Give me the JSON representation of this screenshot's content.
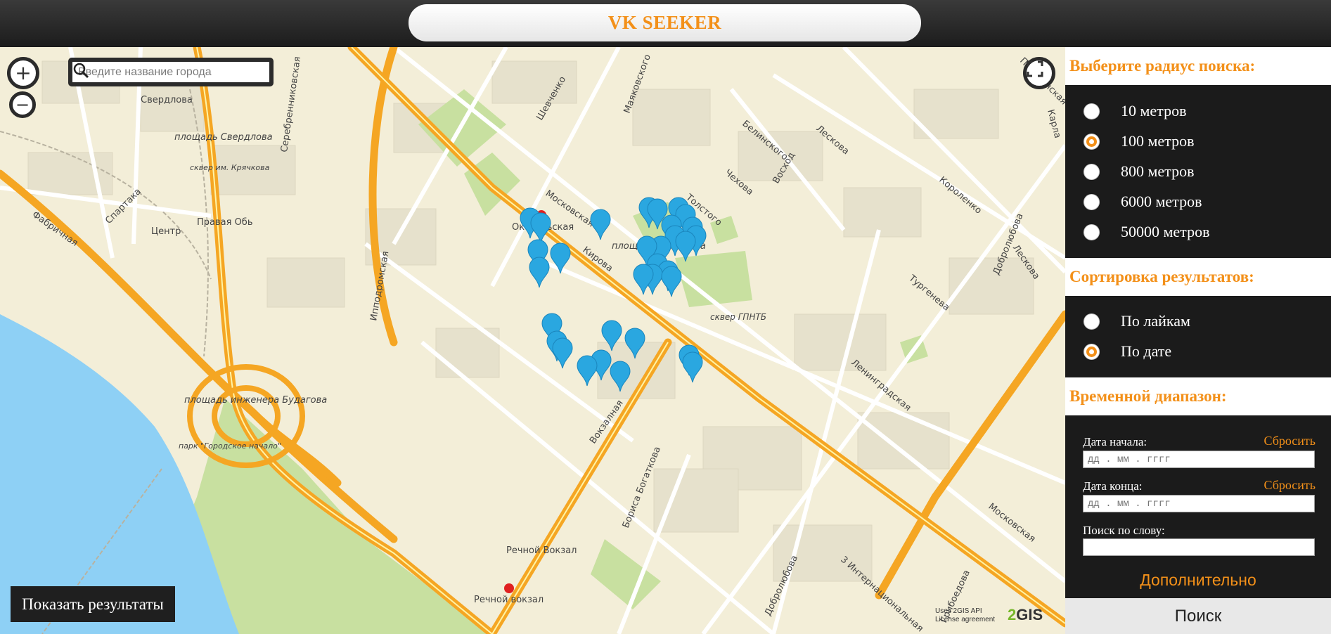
{
  "header": {
    "title": "VK SEEKER"
  },
  "map": {
    "zoom_in_label": "+",
    "zoom_out_label": "−",
    "search_placeholder": "Введите название города",
    "show_results_label": "Показать результаты",
    "credits_line1": "Uses 2GIS API",
    "credits_line2": "License agreement",
    "logo_num": "2",
    "logo_text": "GIS",
    "labels": {
      "sverdlova": "Свердлова",
      "pl_sverdlova": "площадь Свердлова",
      "skver_kryachkova": "сквер им. Крячкова",
      "spartaka": "Спартака",
      "centr": "Центр",
      "pravaya_ob": "Правая Обь",
      "fabrichnaya": "Фабричная",
      "serebrennikovskaya": "Серебренниковская",
      "shevchenko": "Шевченко",
      "mayakovskogo": "Маяковского",
      "belinskogo": "Белинского",
      "leskova": "Лескова",
      "chekhova": "Чехова",
      "voskhod": "Восход",
      "tolstogo": "Толстого",
      "korolenko": "Короленко",
      "moskovskaya": "Московская",
      "oktyabrskaya": "Октябрьская",
      "kirova": "Кирова",
      "ippodromskaya": "Ипподромская",
      "pl_pimenova": "площадь Пименова",
      "skver_gpntb": "сквер ГПНТБ",
      "turgeneva": "Тургенева",
      "dobrolyubova": "Добролюбова",
      "leskova2": "Лескова",
      "leningradskaya": "Ленинградская",
      "pl_budagova": "площадь инженера Будагова",
      "park_gorodskoe": "парк \"Городское начало\"",
      "vokzalnaya": "Вокзалная",
      "borisa_bogatkova": "Бориса Богаткова",
      "rechnoy_vokzal_stop": "Речной Вокзал",
      "rechnoy_vokzal_metro": "Речной вокзал",
      "dobrolyubova2": "Добролюбова",
      "internacionalnaya": "3 Интернациональная",
      "moskovskaya2": "Московская",
      "griboedova": "Грибоедова",
      "prist": "Пристанская",
      "karl": "Карла"
    }
  },
  "panel": {
    "radius_heading": "Выберите радиус поиска:",
    "radius_options": [
      {
        "label": "10 метров",
        "checked": false
      },
      {
        "label": "100 метров",
        "checked": true
      },
      {
        "label": "800 метров",
        "checked": false
      },
      {
        "label": "6000 метров",
        "checked": false
      },
      {
        "label": "50000 метров",
        "checked": false
      }
    ],
    "sort_heading": "Сортировка результатов:",
    "sort_options": [
      {
        "label": "По лайкам",
        "checked": false
      },
      {
        "label": "По дате",
        "checked": true
      }
    ],
    "time_heading": "Временной диапазон:",
    "start_label": "Дата начала:",
    "end_label": "Дата конца:",
    "reset_label": "Сбросить",
    "date_placeholder": "дд . мм . гггг",
    "word_label": "Поиск по слову:",
    "word_value": "",
    "extra_label": "Дополнительно",
    "search_label": "Поиск"
  },
  "colors": {
    "accent": "#f39019",
    "panel_bg": "#1b1b1b",
    "water": "#8ed0f5",
    "road": "#f5a623",
    "park": "#c8e0a0"
  }
}
